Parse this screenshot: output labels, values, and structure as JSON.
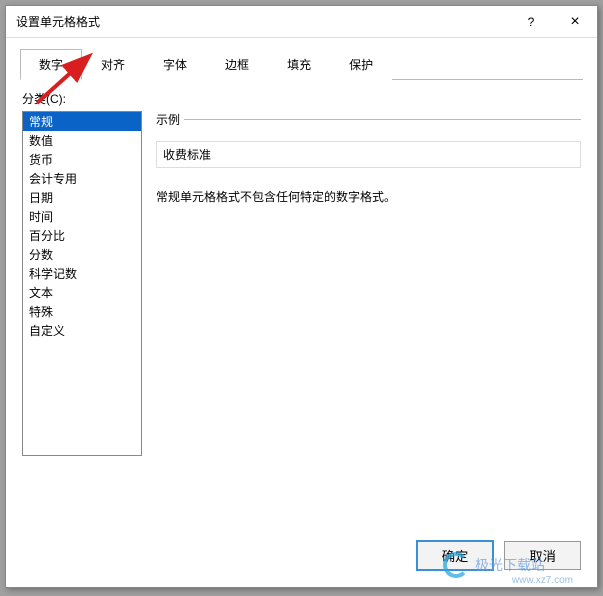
{
  "window": {
    "title": "设置单元格格式",
    "help": "?",
    "close": "×"
  },
  "tabs": {
    "items": [
      {
        "label": "数字"
      },
      {
        "label": "对齐"
      },
      {
        "label": "字体"
      },
      {
        "label": "边框"
      },
      {
        "label": "填充"
      },
      {
        "label": "保护"
      }
    ]
  },
  "category": {
    "label": "分类(C):",
    "items": [
      "常规",
      "数值",
      "货币",
      "会计专用",
      "日期",
      "时间",
      "百分比",
      "分数",
      "科学记数",
      "文本",
      "特殊",
      "自定义"
    ]
  },
  "sample": {
    "title": "示例",
    "value": "收费标准"
  },
  "description": "常规单元格格式不包含任何特定的数字格式。",
  "buttons": {
    "ok": "确定",
    "cancel": "取消"
  },
  "watermark": {
    "text": "极光下载站",
    "url": "www.xz7.com"
  }
}
